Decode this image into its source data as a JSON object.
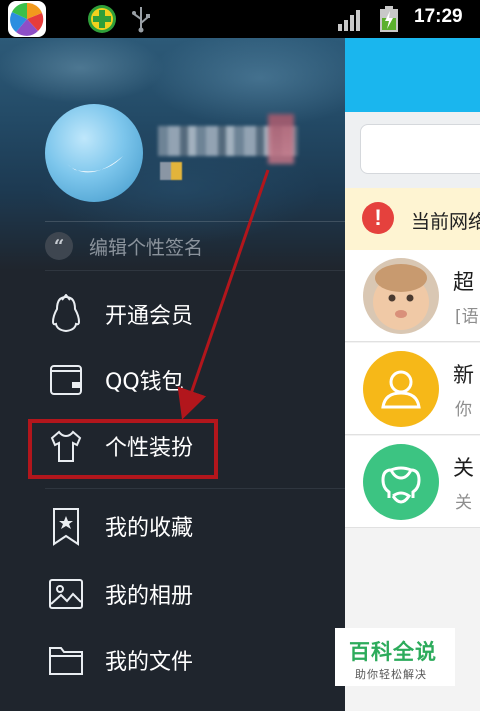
{
  "status_bar": {
    "time": "17:29",
    "icons": [
      "app-store-icon",
      "plus-icon",
      "usb-icon",
      "signal-icon",
      "battery-charging-icon"
    ]
  },
  "drawer": {
    "signature_placeholder": "编辑个性签名",
    "menu_items": [
      {
        "label": "开通会员",
        "icon": "penguin-icon"
      },
      {
        "label": "QQ钱包",
        "icon": "wallet-icon"
      },
      {
        "label": "个性装扮",
        "icon": "tshirt-icon"
      },
      {
        "label": "我的收藏",
        "icon": "bookmark-star-icon"
      },
      {
        "label": "我的相册",
        "icon": "photo-icon"
      },
      {
        "label": "我的文件",
        "icon": "folder-icon"
      }
    ]
  },
  "main": {
    "warning_text": "当前网络",
    "chats": [
      {
        "name": "超",
        "preview": "[语"
      },
      {
        "name": "新",
        "preview": "你"
      },
      {
        "name": "关",
        "preview": "关"
      }
    ]
  },
  "watermark": {
    "title": "百科全说",
    "subtitle": "助你轻松解决"
  },
  "colors": {
    "highlight": "#b2161c",
    "topbar": "#1ab6ee",
    "drawer_bg": "#1f252d",
    "warning_bg": "#fef4d2",
    "warning_icon": "#e5413d",
    "contact_yellow": "#f6b818",
    "contact_green": "#3cc482",
    "watermark_green": "#2cab5b"
  }
}
